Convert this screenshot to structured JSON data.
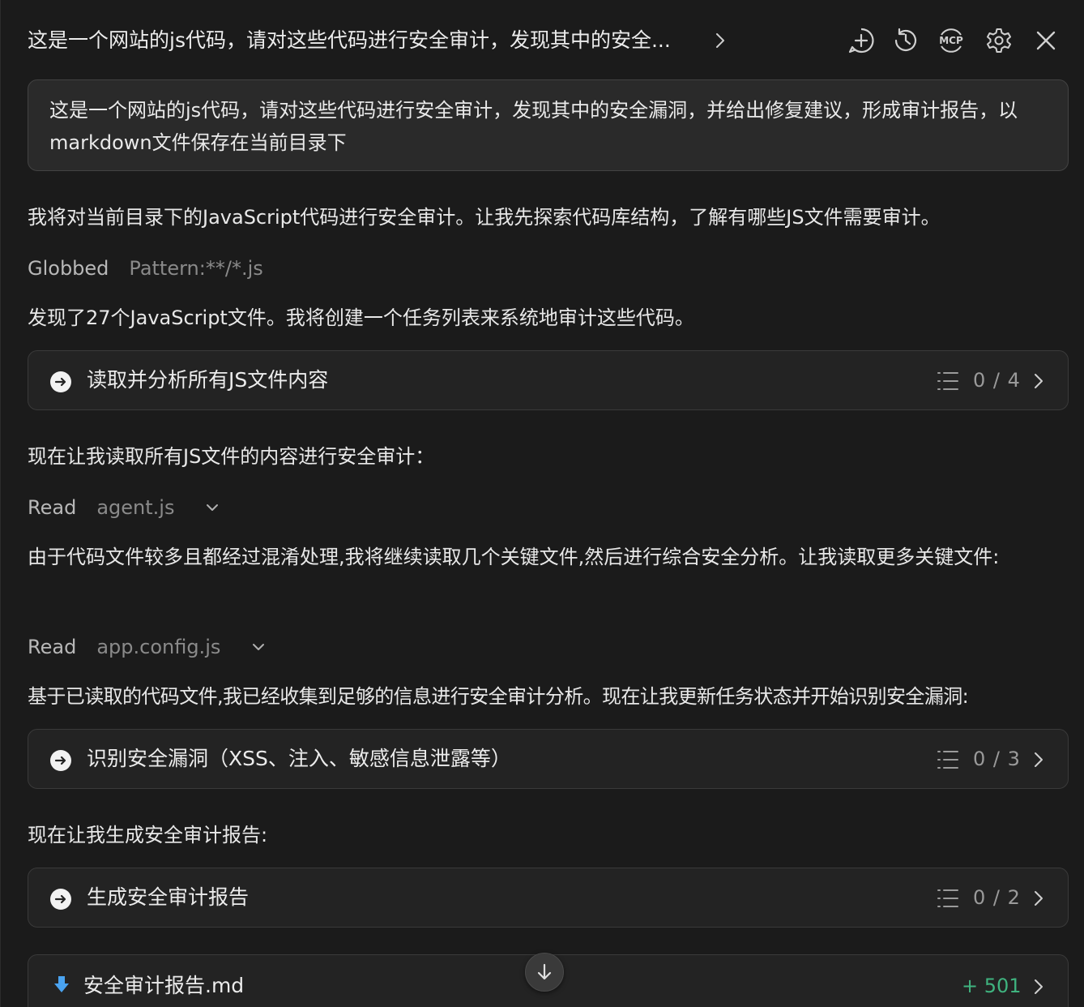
{
  "header": {
    "title": "这是一个网站的js代码，请对这些代码进行安全审计，发现其中的安全...",
    "icons": [
      "new-chat-icon",
      "history-icon",
      "mcp-icon",
      "settings-icon",
      "close-icon"
    ],
    "mcp_label": "MCP"
  },
  "prompt": {
    "text": "这是一个网站的js代码，请对这些代码进行安全审计，发现其中的安全漏洞，并给出修复建议，形成审计报告，以markdown文件保存在当前目录下"
  },
  "messages": {
    "intro": "我将对当前目录下的JavaScript代码进行安全审计。让我先探索代码库结构，了解有哪些JS文件需要审计。",
    "found": "发现了27个JavaScript文件。我将创建一个任务列表来系统地审计这些代码。",
    "read_all": "现在让我读取所有JS文件的内容进行安全审计：",
    "many_files": "由于代码文件较多且都经过混淆处理,我将继续读取几个关键文件,然后进行综合安全分析。让我读取更多关键文件:",
    "collected": "基于已读取的代码文件,我已经收集到足够的信息进行安全审计分析。现在让我更新任务状态并开始识别安全漏洞:",
    "generate": "现在让我生成安全审计报告:"
  },
  "tools": {
    "glob": {
      "verb": "Globbed",
      "arg": "Pattern:**/*.js"
    },
    "read1": {
      "verb": "Read",
      "arg": "agent.js"
    },
    "read2": {
      "verb": "Read",
      "arg": "app.config.js"
    }
  },
  "tasks": [
    {
      "label": "读取并分析所有JS文件内容",
      "count": "0 / 4"
    },
    {
      "label": "识别安全漏洞（XSS、注入、敏感信息泄露等）",
      "count": "0 / 3"
    },
    {
      "label": "生成安全审计报告",
      "count": "0 / 2"
    }
  ],
  "file": {
    "name": "安全审计报告.md",
    "diff": "+ 501"
  },
  "colors": {
    "background": "#1b1b1b",
    "card": "#232323",
    "accent_green": "#3fb37f",
    "file_icon_blue": "#4aa3f0"
  }
}
